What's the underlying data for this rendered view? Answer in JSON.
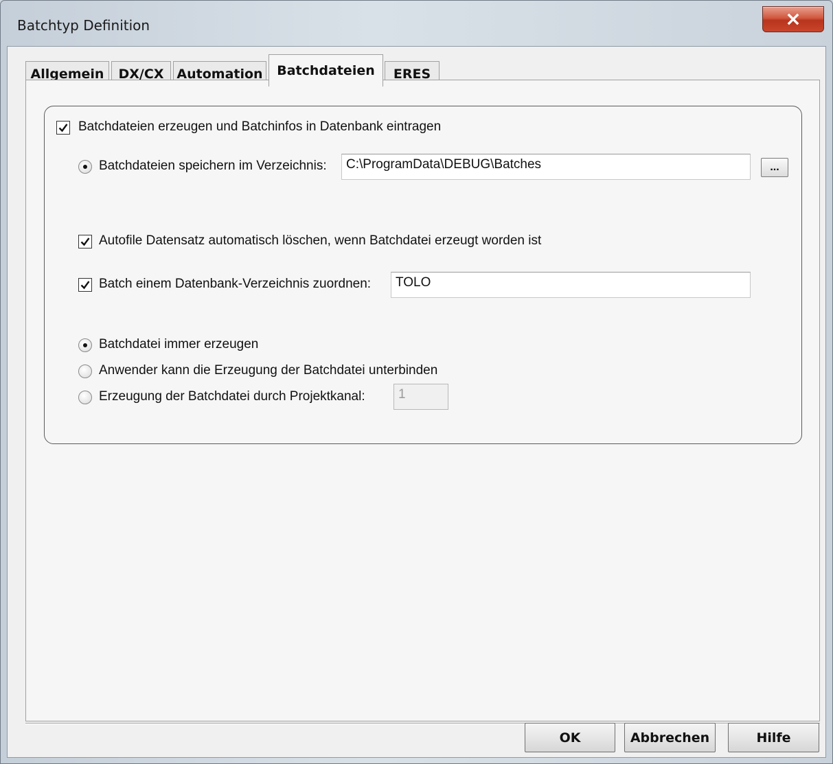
{
  "window": {
    "title": "Batchtyp Definition"
  },
  "tabs": [
    {
      "label": "Allgemein"
    },
    {
      "label": "DX/CX"
    },
    {
      "label": "Automation"
    },
    {
      "label": "Batchdateien"
    },
    {
      "label": "ERES"
    }
  ],
  "active_tab": "Batchdateien",
  "panel": {
    "main_checkbox": {
      "label": "Batchdateien erzeugen und Batchinfos in Datenbank eintragen",
      "checked": true
    },
    "save_dir": {
      "label": "Batchdateien speichern im Verzeichnis:",
      "value": "C:\\ProgramData\\DEBUG\\Batches",
      "browse_label": "...",
      "selected": true
    },
    "autofile_delete": {
      "label": "Autofile Datensatz automatisch löschen, wenn Batchdatei erzeugt worden ist",
      "checked": true
    },
    "db_dir": {
      "label": "Batch einem Datenbank-Verzeichnis zuordnen:",
      "value": "TOLO",
      "checked": true
    },
    "radio_options": [
      {
        "label": "Batchdatei immer erzeugen",
        "selected": true
      },
      {
        "label": "Anwender kann die Erzeugung der Batchdatei unterbinden",
        "selected": false
      },
      {
        "label": "Erzeugung der Batchdatei durch Projektkanal:",
        "selected": false
      }
    ],
    "projektkanal_value": "1"
  },
  "buttons": {
    "ok": "OK",
    "cancel": "Abbrechen",
    "help": "Hilfe"
  }
}
